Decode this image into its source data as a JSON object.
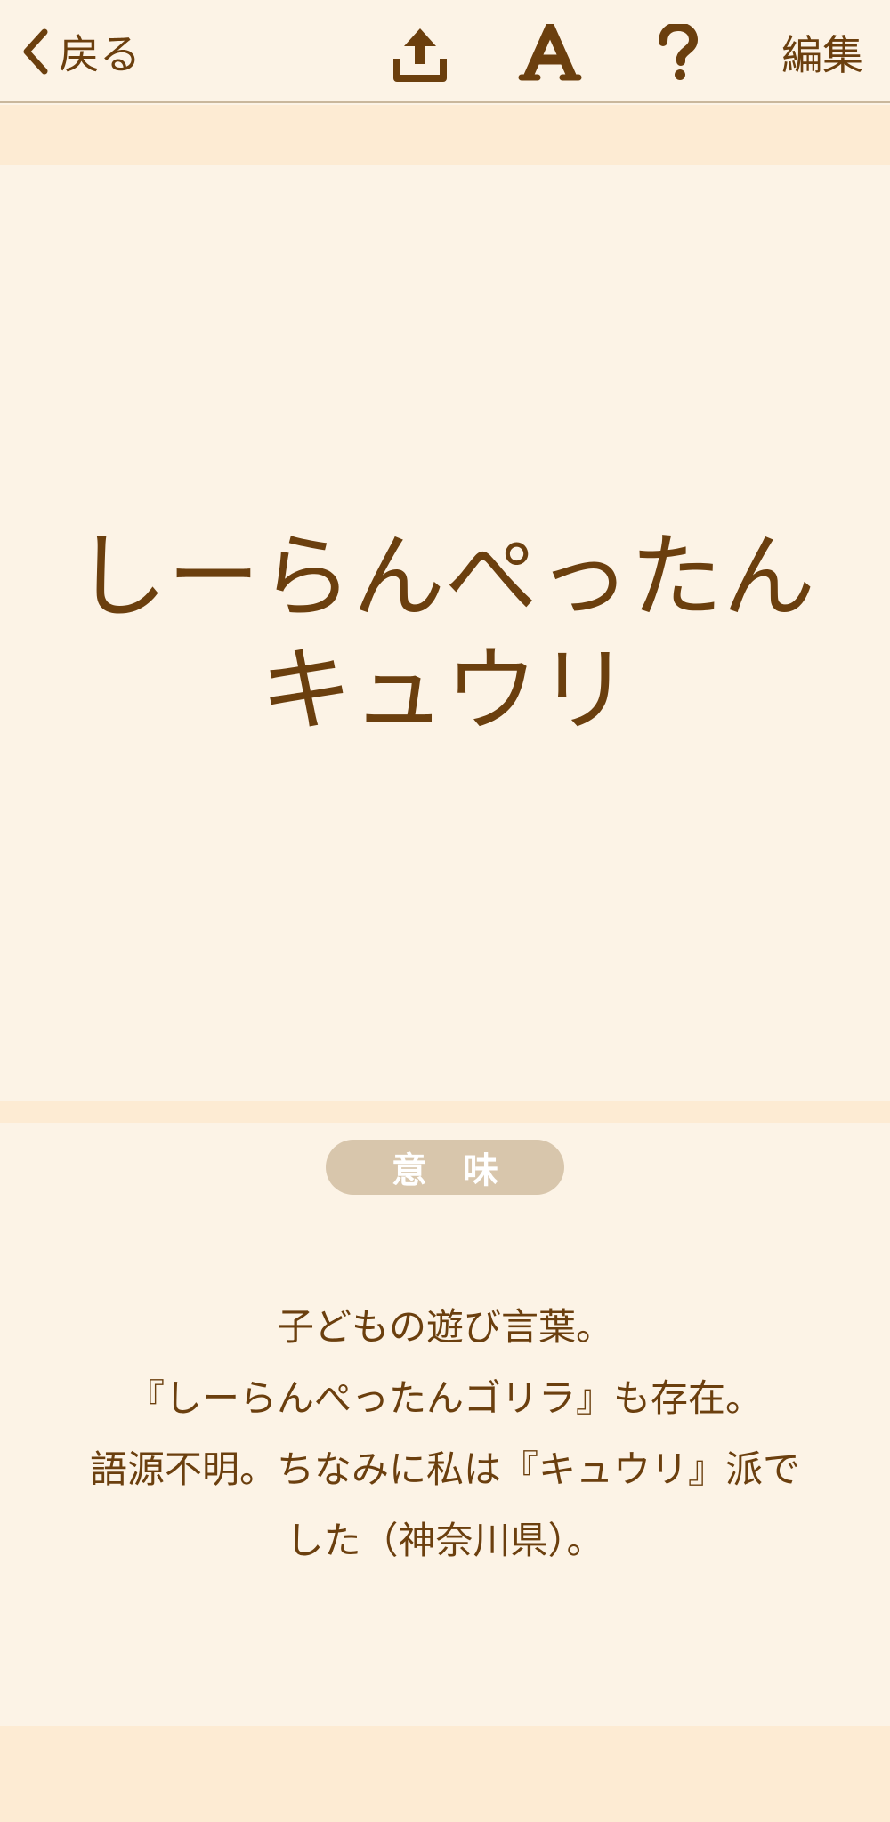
{
  "nav": {
    "back_label": "戻る",
    "edit_label": "編集",
    "icons": [
      "share-icon",
      "font-size-icon",
      "help-icon"
    ]
  },
  "word": {
    "lines": [
      "しーらんぺったん",
      "キュウリ"
    ]
  },
  "meaning": {
    "heading": "意味",
    "lines": [
      "子どもの遊び言葉。",
      "『しーらんぺったんゴリラ』も存在。",
      "語源不明。ちなみに私は『キュウリ』派で",
      "した（神奈川県）。"
    ]
  },
  "colors": {
    "background": "#fcf3e6",
    "band": "#fdebd3",
    "text_brown": "#6b3f0e",
    "pill": "#d8c6ac"
  }
}
